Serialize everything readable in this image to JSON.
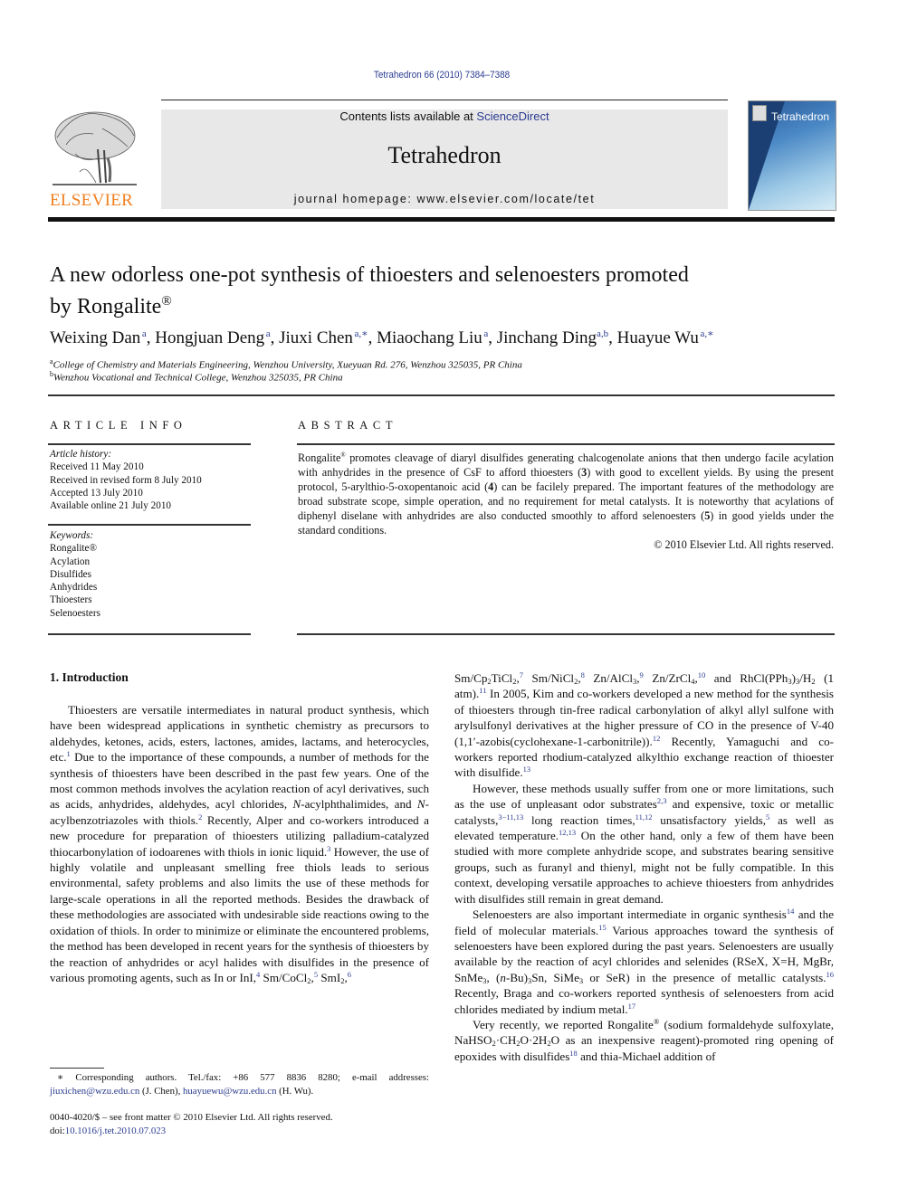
{
  "header": {
    "citation": "Tetrahedron 66 (2010) 7384–7388",
    "contents_prefix": "Contents lists available at ",
    "contents_link": "ScienceDirect",
    "journal_name": "Tetrahedron",
    "homepage": "journal homepage: www.elsevier.com/locate/tet",
    "publisher_logo_text": "ELSEVIER",
    "cover_title": "Tetrahedron",
    "colors": {
      "link": "#2a3b8f",
      "elsevier_orange": "#f07f20",
      "banner_bg": "#e8e8e8"
    }
  },
  "article": {
    "title_line1": "A new odorless one-pot synthesis of thioesters and selenoesters promoted",
    "title_line2": "by Rongalite",
    "title_mark": "®",
    "authors": [
      {
        "name": "Weixing Dan",
        "affil": "a"
      },
      {
        "name": "Hongjuan Deng",
        "affil": "a"
      },
      {
        "name": "Jiuxi Chen",
        "affil": "a,∗"
      },
      {
        "name": "Miaochang Liu",
        "affil": "a"
      },
      {
        "name": "Jinchang Ding",
        "affil": "a,b"
      },
      {
        "name": "Huayue Wu",
        "affil": "a,∗"
      }
    ],
    "affiliations": [
      {
        "mark": "a",
        "text": "College of Chemistry and Materials Engineering, Wenzhou University, Xueyuan Rd. 276, Wenzhou 325035, PR China"
      },
      {
        "mark": "b",
        "text": "Wenzhou Vocational and Technical College, Wenzhou 325035, PR China"
      }
    ]
  },
  "article_info": {
    "heading": "ARTICLE INFO",
    "history_label": "Article history:",
    "history": [
      "Received 11 May 2010",
      "Received in revised form 8 July 2010",
      "Accepted 13 July 2010",
      "Available online 21 July 2010"
    ],
    "keywords_label": "Keywords:",
    "keywords": [
      "Rongalite®",
      "Acylation",
      "Disulfides",
      "Anhydrides",
      "Thioesters",
      "Selenoesters"
    ]
  },
  "abstract": {
    "heading": "ABSTRACT",
    "p1": "Rongalite",
    "p2": " promotes cleavage of diaryl disulfides generating chalcogenolate anions that then undergo facile acylation with anhydrides in the presence of CsF to afford thioesters (",
    "c3": "3",
    "p3": ") with good to excellent yields. By using the present protocol, 5-arylthio-5-oxopentanoic acid (",
    "c4": "4",
    "p4": ") can be facilely prepared. The important features of the methodology are broad substrate scope, simple operation, and no requirement for metal catalysts. It is noteworthy that acylations of diphenyl diselane with anhydrides are also conducted smoothly to afford selenoesters (",
    "c5": "5",
    "p5": ") in good yields under the standard conditions.",
    "copyright": "© 2010 Elsevier Ltd. All rights reserved."
  },
  "intro": {
    "heading": "1.  Introduction",
    "left": {
      "s1": "Thioesters are versatile intermediates in natural product synthesis, which have been widespread applications in synthetic chemistry as precursors to aldehydes, ketones, acids, esters, lactones, amides, lactams, and heterocycles, etc.",
      "r1": "1",
      "s2": " Due to the importance of these compounds, a number of methods for the synthesis of thioesters have been described in the past few years. One of the most common methods involves the acylation reaction of acyl derivatives, such as acids, anhydrides, aldehydes, acyl chlorides, ",
      "n1": "N",
      "s3": "-acylphthalimides, and ",
      "n2": "N",
      "s4": "-acylbenzotriazoles with thiols.",
      "r2": "2",
      "s5": " Recently, Alper and co-workers introduced a new procedure for preparation of thioesters utilizing palladium-catalyzed thiocarbonylation of iodoarenes with thiols in ionic liquid.",
      "r3": "3",
      "s6": " However, the use of highly volatile and unpleasant smelling free thiols leads to serious environmental, safety problems and also limits the use of these methods for large-scale operations in all the reported methods. Besides the drawback of these methodologies are associated with undesirable side reactions owing to the oxidation of thiols. In order to minimize or eliminate the encountered problems, the method has been developed in recent years for the synthesis of thioesters by the reaction of anhydrides or acyl halides with disulfides in the presence of various promoting agents, such as In or InI,",
      "r4": "4",
      "s7": " Sm/CoCl",
      "r5": "5",
      "s8": " SmI",
      "r6": "6"
    },
    "right": {
      "a1": "Sm/Cp",
      "a2": "TiCl",
      "r7": "7",
      "a3": " Sm/NiCl",
      "r8": "8",
      "a4": " Zn/AlCl",
      "r9": "9",
      "a5": " Zn/ZrCl",
      "r10": "10",
      "a6": " and RhCl(PPh",
      "a7": "/H",
      "a8": " (1 atm).",
      "r11": "11",
      "a9": " In 2005, Kim and co-workers developed a new method for the synthesis of thioesters through tin-free radical carbonylation of alkyl allyl sulfone with arylsulfonyl derivatives at the higher pressure of CO in the presence of V-40 (1,1′-azobis(cyclohexane-1-carbonitrile)).",
      "r12": "12",
      "a10": " Recently, Yamaguchi and co-workers reported rhodium-catalyzed alkylthio exchange reaction of thioester with disulfide.",
      "r13": "13",
      "b1": "However, these methods usually suffer from one or more limitations, such as the use of unpleasant odor substrates",
      "rb1": "2,3",
      "b2": " and expensive, toxic or metallic catalysts,",
      "rb2": "3−11,13",
      "b3": " long reaction times,",
      "rb3": "11,12",
      "b4": " unsatisfactory yields,",
      "rb4": "5",
      "b5": " as well as elevated temperature.",
      "rb5": "12,13",
      "b6": " On the other hand, only a few of them have been studied with more complete anhydride scope, and substrates bearing sensitive groups, such as furanyl and thienyl, might not be fully compatible. In this context, developing versatile approaches to achieve thioesters from anhydrides with disulfides still remain in great demand.",
      "c1": "Selenoesters are also important intermediate in organic synthesis",
      "rc1": "14",
      "c2": " and the field of molecular materials.",
      "rc2": "15",
      "c3": " Various approaches toward the synthesis of selenoesters have been explored during the past years. Selenoesters are usually available by the reaction of acyl chlorides and selenides (RSeX, X=H, MgBr, SnMe",
      "c4": ", (",
      "c4n": "n",
      "c5": "-Bu)",
      "c6": "Sn, SiMe",
      "c7": " or SeR) in the presence of metallic catalysts.",
      "rc3": "16",
      "c8": " Recently, Braga and co-workers reported synthesis of selenoesters from acid chlorides mediated by indium metal.",
      "rc4": "17",
      "d1": "Very recently, we reported Rongalite",
      "d_mark": "®",
      "d2": " (sodium formaldehyde sulfoxylate, NaHSO",
      "d3": "·CH",
      "d4": "O·2H",
      "d5": "O as an inexpensive reagent)-promoted ring opening of epoxides with disulfides",
      "rd1": "18",
      "d6": " and thia-Michael addition of"
    }
  },
  "footnotes": {
    "corresponding": "∗  Corresponding authors. Tel./fax: +86 577 8836 8280; e-mail addresses: ",
    "email1": "jiuxichen@wzu.edu.cn",
    "after1": " (J. Chen), ",
    "email2": "huayuewu@wzu.edu.cn",
    "after2": " (H. Wu).",
    "issn": "0040-4020/$ – see front matter © 2010 Elsevier Ltd. All rights reserved.",
    "doi_label": "doi:",
    "doi": "10.1016/j.tet.2010.07.023"
  }
}
